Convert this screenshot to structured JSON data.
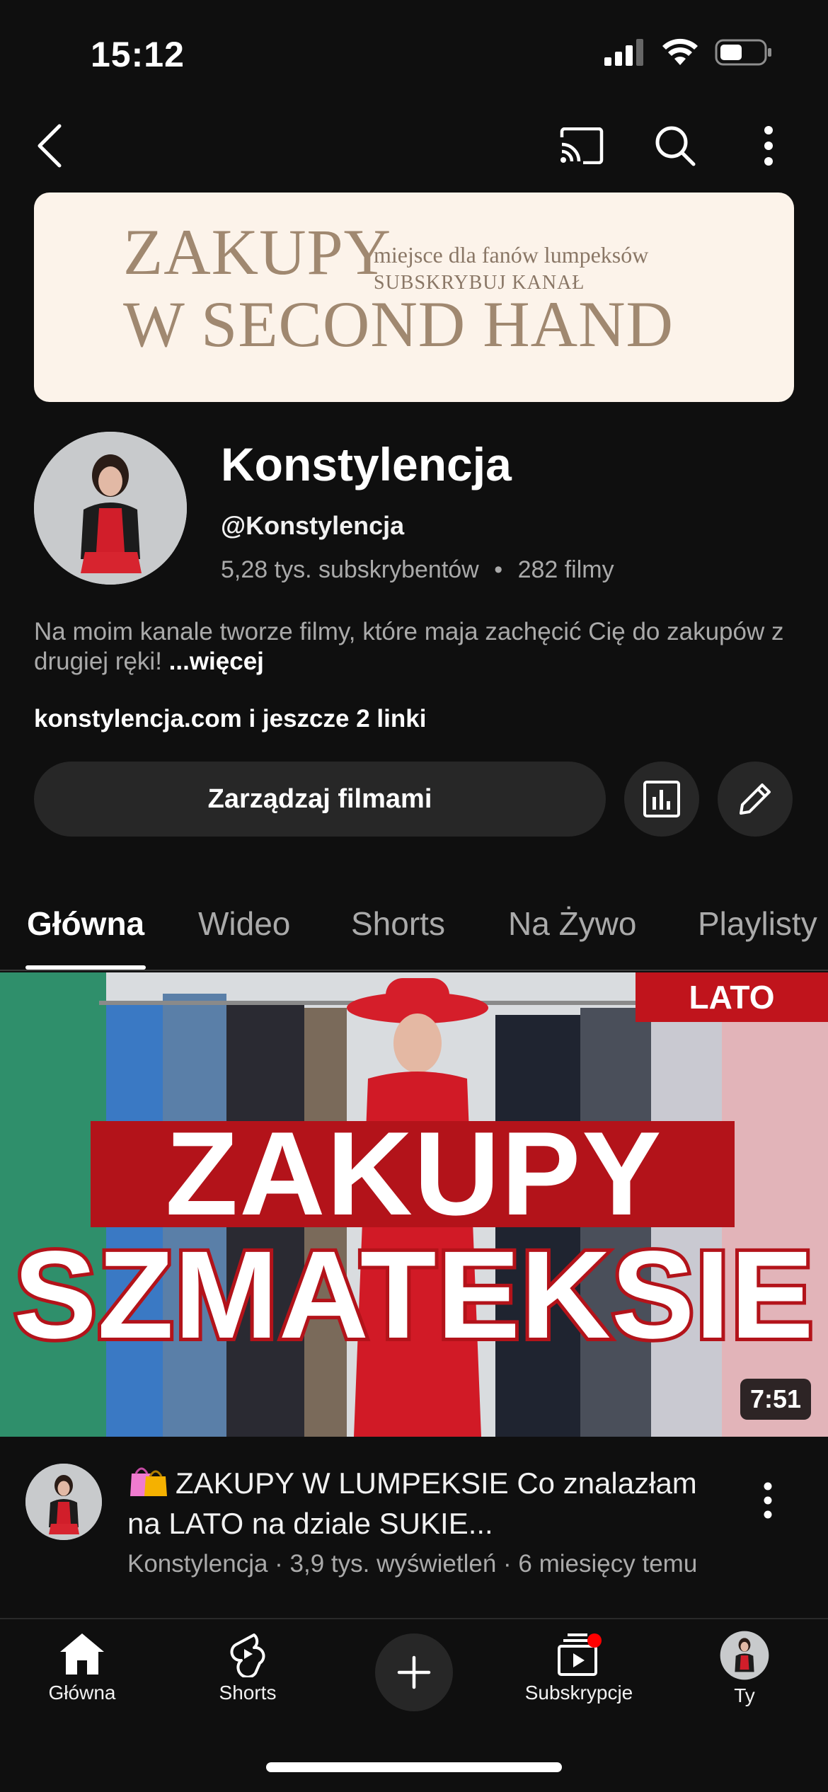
{
  "status_bar": {
    "time": "15:12"
  },
  "banner": {
    "line1": "ZAKUPY",
    "line2": "W SECOND HAND",
    "tagline": "miejsce dla fanów lumpeksów",
    "cta": "SUBSKRYBUJ  KANAŁ"
  },
  "channel": {
    "name": "Konstylencja",
    "handle": "@Konstylencja",
    "subscribers": "5,28 tys. subskrybentów",
    "separator": "•",
    "videos": "282 filmy",
    "description": "Na moim kanale tworze filmy, które maja zachęcić Cię do zakupów z drugiej ręki!",
    "more_label": "...więcej",
    "links": "konstylencja.com i jeszcze 2 linki",
    "manage_button": "Zarządzaj filmami"
  },
  "tabs": [
    {
      "label": "Główna",
      "active": true
    },
    {
      "label": "Wideo"
    },
    {
      "label": "Shorts"
    },
    {
      "label": "Na Żywo"
    },
    {
      "label": "Playlisty"
    }
  ],
  "video": {
    "badge": "LATO",
    "thumb_text1": "ZAKUPY",
    "thumb_text2": "SZMATEKSIE",
    "duration": "7:51",
    "title": "ZAKUPY W LUMPEKSIE Co znalazłam na LATO na dziale SUKIE...",
    "meta": "Konstylencja · 3,9 tys. wyświetleń · 6 miesięcy temu"
  },
  "bottom_nav": {
    "home": "Główna",
    "shorts": "Shorts",
    "subscriptions": "Subskrypcje",
    "you": "Ty"
  },
  "colors": {
    "background": "#0f0f0f",
    "surface": "#272727",
    "accent_red": "#ff0000",
    "banner_bg": "#fcf3ea",
    "banner_text": "#a08870"
  }
}
